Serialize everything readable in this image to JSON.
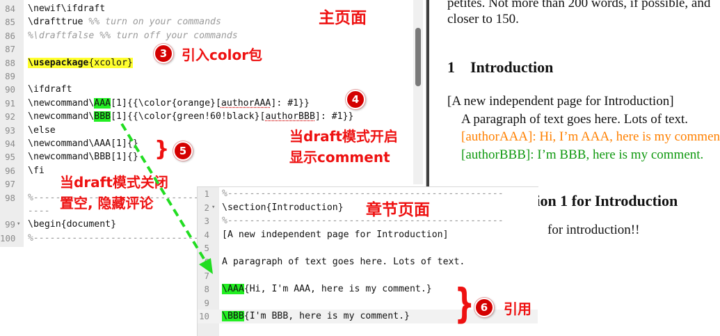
{
  "main_editor": {
    "lines": [
      {
        "no": "84",
        "fold": "",
        "parts": [
          {
            "t": "\\newif\\ifdraft"
          }
        ]
      },
      {
        "no": "85",
        "fold": "",
        "parts": [
          {
            "t": "\\drafttrue "
          },
          {
            "t": "%% turn on your commands",
            "c": "cm"
          }
        ]
      },
      {
        "no": "86",
        "fold": "",
        "parts": [
          {
            "t": "%\\draftfalse %% turn off your commands",
            "c": "cm"
          }
        ]
      },
      {
        "no": "87",
        "fold": "",
        "parts": []
      },
      {
        "no": "88",
        "fold": "",
        "parts": [
          {
            "t": "\\usepackage",
            "c": "kw hl-y"
          },
          {
            "t": "{xcolor}",
            "c": "hl-y"
          }
        ]
      },
      {
        "no": "89",
        "fold": "",
        "parts": []
      },
      {
        "no": "90",
        "fold": "",
        "parts": [
          {
            "t": "\\ifdraft"
          }
        ]
      },
      {
        "no": "91",
        "fold": "",
        "parts": [
          {
            "t": "\\newcommand\\"
          },
          {
            "t": "AAA",
            "c": "hl-g"
          },
          {
            "t": "[1]{{\\color{orange}["
          },
          {
            "t": "authorAAA",
            "c": "squig"
          },
          {
            "t": "]: #1}}"
          }
        ]
      },
      {
        "no": "92",
        "fold": "",
        "parts": [
          {
            "t": "\\newcommand\\"
          },
          {
            "t": "BBB",
            "c": "hl-g"
          },
          {
            "t": "[1]{{\\color{green!60!black}["
          },
          {
            "t": "authorBBB",
            "c": "squig"
          },
          {
            "t": "]: #1}}"
          }
        ]
      },
      {
        "no": "93",
        "fold": "",
        "parts": [
          {
            "t": "\\else"
          }
        ]
      },
      {
        "no": "94",
        "fold": "",
        "parts": [
          {
            "t": "\\newcommand\\AAA[1]{}"
          }
        ]
      },
      {
        "no": "95",
        "fold": "",
        "parts": [
          {
            "t": "\\newcommand\\BBB[1]{}"
          }
        ]
      },
      {
        "no": "96",
        "fold": "",
        "parts": [
          {
            "t": "\\fi"
          }
        ]
      },
      {
        "no": "97",
        "fold": "",
        "parts": []
      },
      {
        "no": "98",
        "fold": "",
        "parts": [
          {
            "t": "%-----------------------------------------------------------",
            "c": "cm"
          }
        ]
      },
      {
        "no": "",
        "fold": "",
        "parts": [
          {
            "t": "----",
            "c": "cm"
          }
        ]
      },
      {
        "no": "99",
        "fold": "▾",
        "parts": [
          {
            "t": "\\begin{document}"
          }
        ]
      },
      {
        "no": "100",
        "fold": "",
        "parts": [
          {
            "t": "%-----------------------------------------------------------",
            "c": "cm"
          }
        ]
      }
    ]
  },
  "chapter_editor": {
    "lines": [
      {
        "no": "1",
        "fold": "",
        "parts": [
          {
            "t": "%--------------------------------------------------",
            "c": "cm"
          }
        ]
      },
      {
        "no": "2",
        "fold": "▾",
        "parts": [
          {
            "t": "\\section{Introduction}"
          }
        ]
      },
      {
        "no": "3",
        "fold": "",
        "parts": [
          {
            "t": "%--------------------------------------------------",
            "c": "cm"
          }
        ]
      },
      {
        "no": "4",
        "fold": "",
        "parts": [
          {
            "t": "[A new independent page for Introduction]"
          }
        ]
      },
      {
        "no": "5",
        "fold": "",
        "parts": []
      },
      {
        "no": "6",
        "fold": "",
        "parts": [
          {
            "t": "A paragraph of text goes here. Lots of text."
          }
        ]
      },
      {
        "no": "7",
        "fold": "",
        "parts": []
      },
      {
        "no": "8",
        "fold": "",
        "parts": [
          {
            "t": "\\AAA",
            "c": "hl-g"
          },
          {
            "t": "{Hi, I'm AAA, here is my comment.}"
          }
        ]
      },
      {
        "no": "9",
        "fold": "",
        "parts": []
      },
      {
        "no": "10",
        "fold": "",
        "parts": [
          {
            "t": "\\BBB",
            "c": "hl-g"
          },
          {
            "t": "{I'm BBB, here is my comment.}"
          }
        ]
      }
    ]
  },
  "preview": {
    "line1": "petites. Not more than 200 words, if possible, and",
    "line2": "closer to 150.",
    "section_number": "1",
    "section_title": "Introduction",
    "page_note": "[A new independent page for Introduction]",
    "paragraph": "A paragraph of text goes here. Lots of text.",
    "comment_aaa": "[authorAAA]: Hi, I’m AAA, here is my comment.",
    "comment_bbb": "[authorBBB]: I’m BBB, here is my comment.",
    "subsection_title": "tion 1 for Introduction",
    "subsection_text": "for introduction!!"
  },
  "annotations": {
    "main_page": "主页面",
    "chapter_page": "章节页面",
    "badge3": "3",
    "badge3_text": "引入color包",
    "badge4": "4",
    "badge4_text_1": "当draft模式开启",
    "badge4_text_2": "显示comment",
    "badge5": "5",
    "draft_off_1": "当draft模式关闭",
    "draft_off_2": "置空, 隐藏评论",
    "badge6": "6",
    "badge6_text": "引用"
  },
  "colors": {
    "annotation_red": "#ee1111",
    "highlight_yellow": "#ffff2e",
    "highlight_green": "#22ee22",
    "arrow_green": "#22dd22",
    "orange_text": "#ff8000",
    "green_text": "#109910"
  }
}
